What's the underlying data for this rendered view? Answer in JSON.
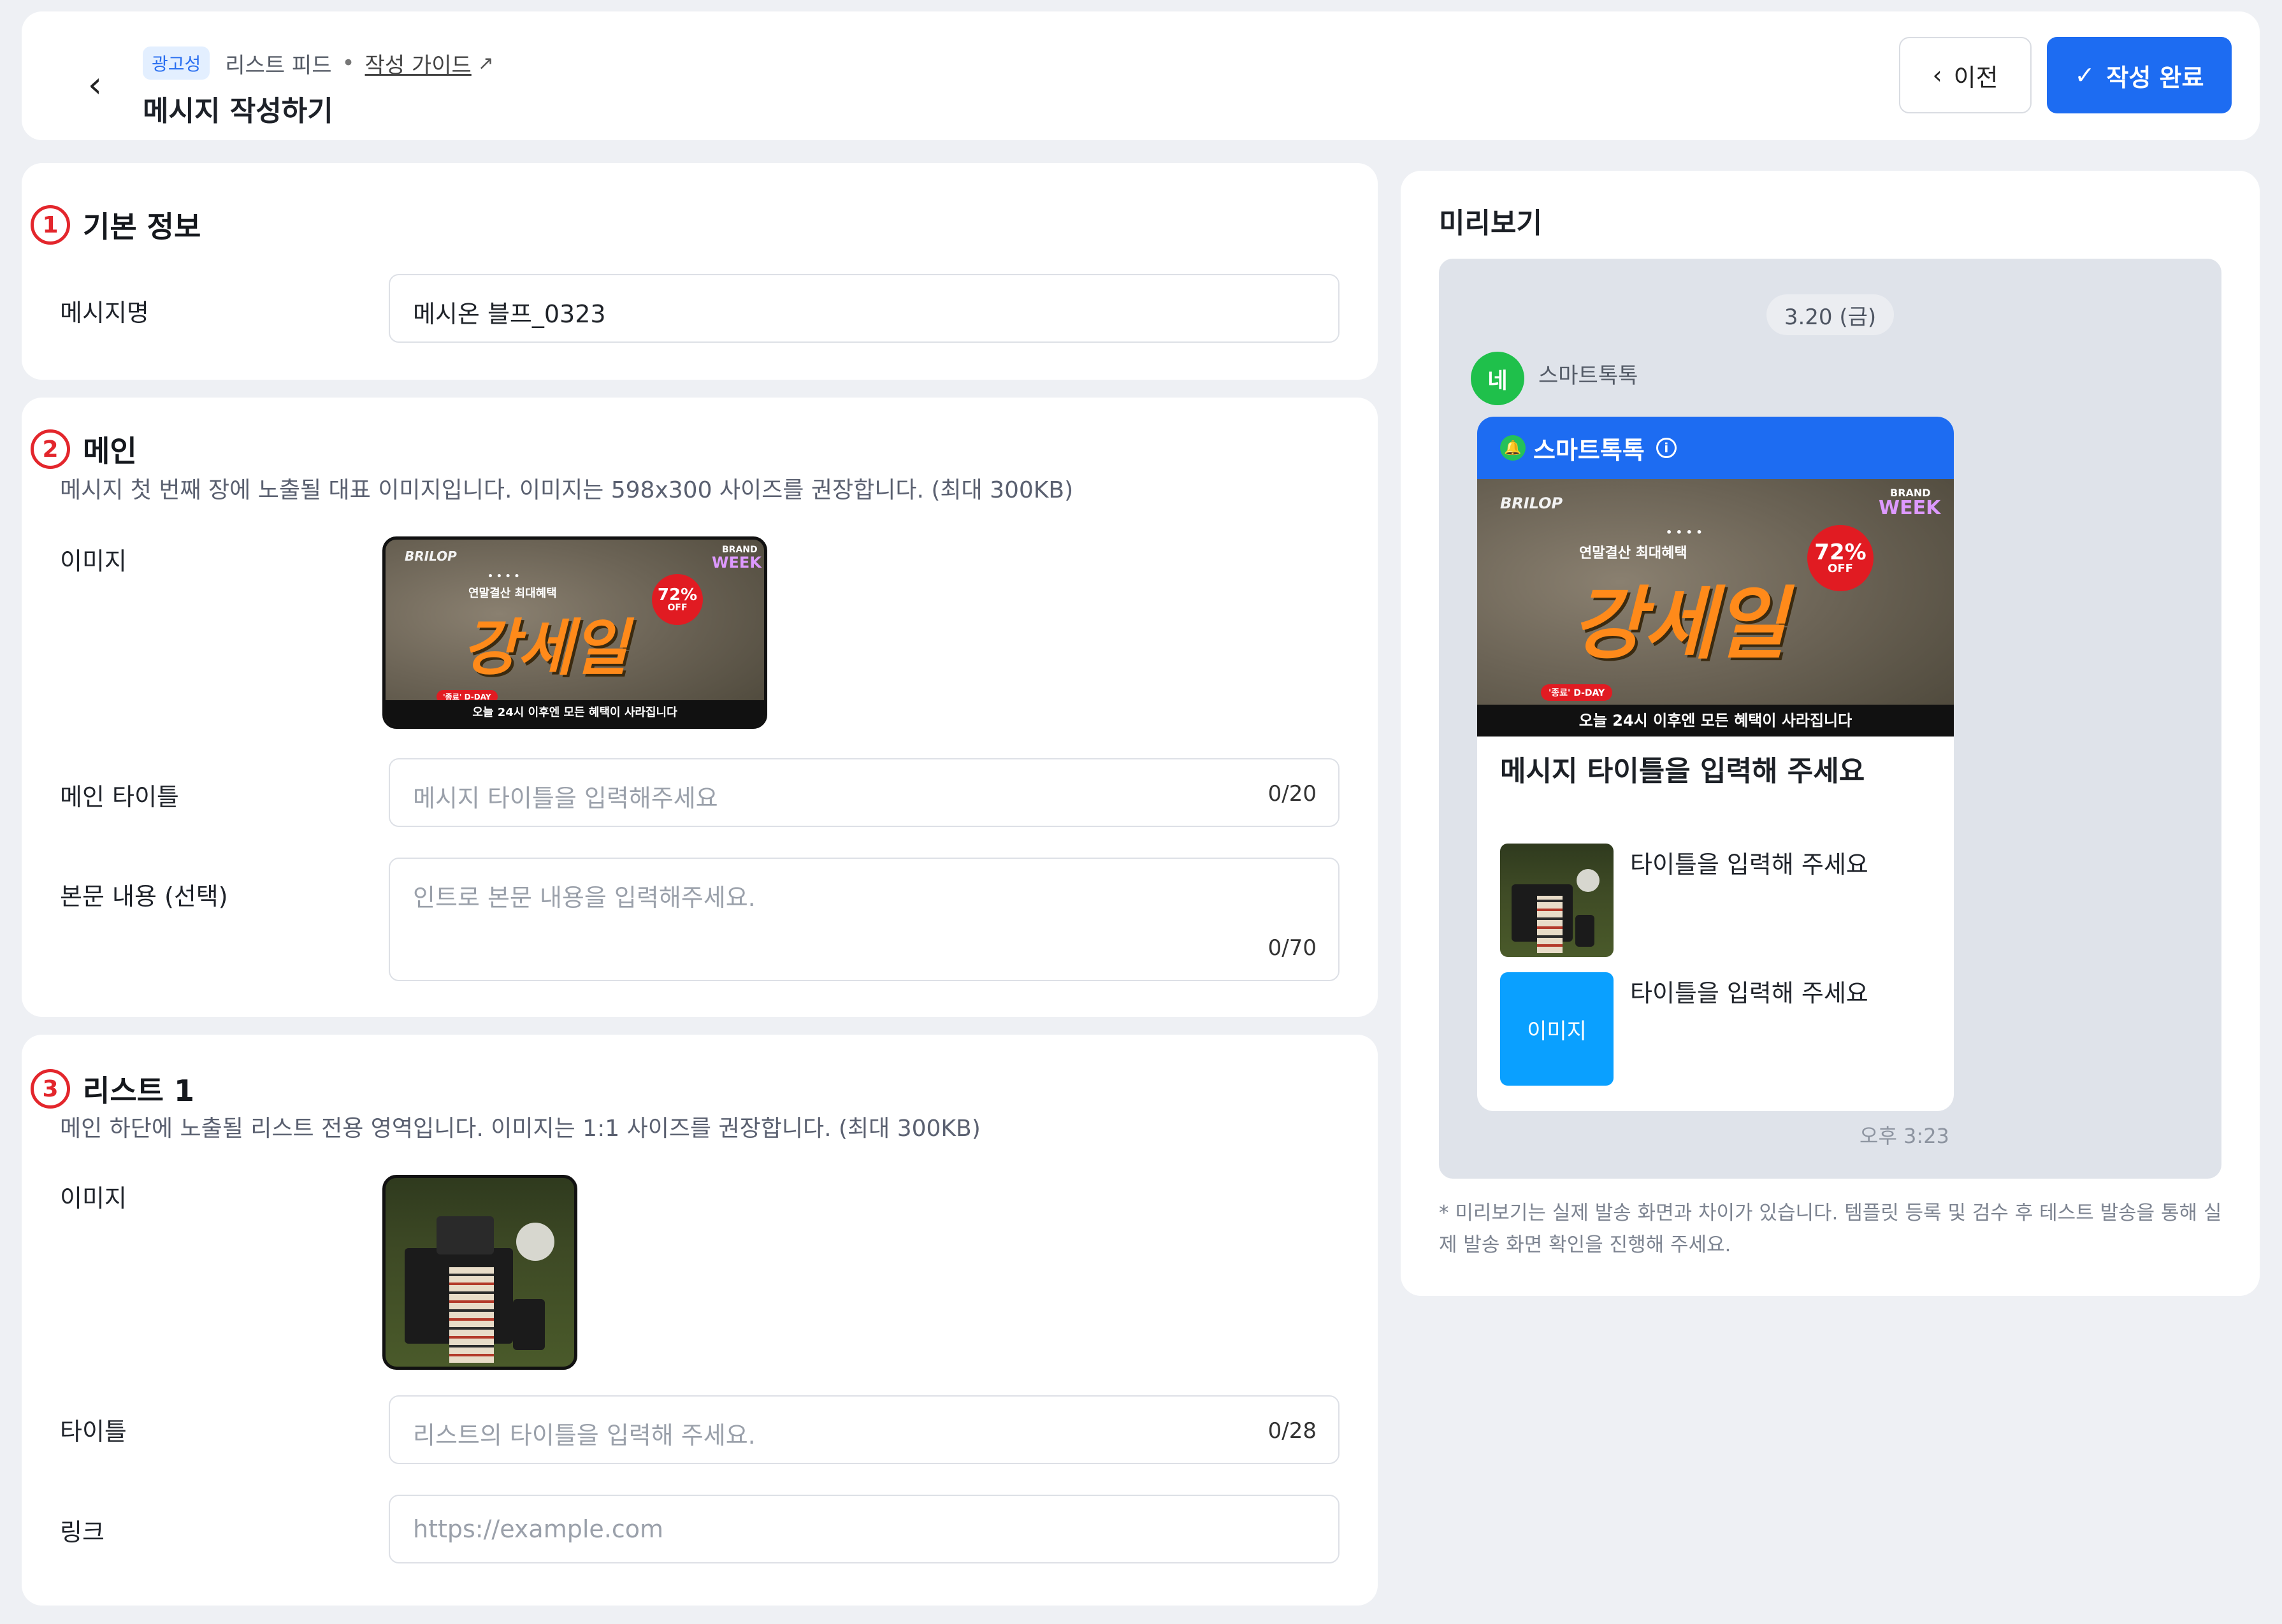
{
  "header": {
    "back_icon": "chevron-left",
    "badge": "광고성",
    "feed_type": "리스트 피드",
    "separator": "•",
    "guide_link": "작성 가이드",
    "guide_icon": "external-link",
    "page_title": "메시지 작성하기",
    "prev_label": "이전",
    "done_label": "작성 완료",
    "accent_color": "#1d6cf2"
  },
  "basic": {
    "number": "1",
    "title": "기본 정보",
    "name_label": "메시지명",
    "name_value": "메시온 블프_0323"
  },
  "main": {
    "number": "2",
    "title": "메인",
    "description": "메시지 첫 번째 장에 노출될 대표 이미지입니다. 이미지는 598x300 사이즈를 권장합니다. (최대 300KB)",
    "image_label": "이미지",
    "title_label": "메인 타이틀",
    "title_placeholder": "메시지 타이틀을 입력해주세요",
    "title_count": "0/20",
    "body_label": "본문 내용 (선택)",
    "body_placeholder": "인트로 본문 내용을 입력해주세요.",
    "body_count": "0/70"
  },
  "banner": {
    "brand": "BRILOP",
    "week_top": "BRAND",
    "week": "WEEK",
    "dots": "• • • •",
    "subtitle": "연말결산 최대혜택",
    "headline": "강세일",
    "discount": "72%",
    "off": "OFF",
    "dday": "'종료' D-DAY",
    "bottom_text": "오늘 24시 이후엔 모든 혜택이 사라집니다"
  },
  "list1": {
    "number": "3",
    "title": "리스트 1",
    "description": "메인 하단에 노출될 리스트 전용 영역입니다. 이미지는 1:1 사이즈를 권장합니다. (최대 300KB)",
    "image_label": "이미지",
    "title_label": "타이틀",
    "title_placeholder": "리스트의 타이틀을 입력해 주세요.",
    "title_count": "0/28",
    "link_label": "링크",
    "link_placeholder": "https://example.com"
  },
  "preview": {
    "title": "미리보기",
    "date": "3.20 (금)",
    "avatar": "네",
    "sender": "스마트톡톡",
    "channel": "스마트톡톡",
    "info_icon": "info",
    "bubble_title": "메시지 타이틀을 입력해 주세요",
    "item1_title": "타이틀을 입력해 주세요",
    "item2_title": "타이틀을 입력해 주세요",
    "item2_placeholder": "이미지",
    "time": "오후 3:23",
    "note": "* 미리보기는 실제 발송 화면과 차이가 있습니다. 템플릿 등록 및 검수 후 테스트 발송을 통해 실제 발송 화면 확인을 진행해 주세요."
  }
}
